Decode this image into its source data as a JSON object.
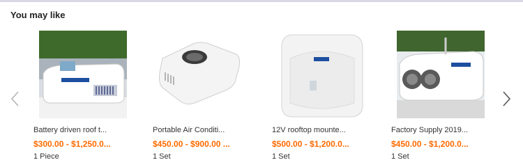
{
  "section": {
    "title": "You may like"
  },
  "nav": {
    "prev_icon": "chevron-left-icon",
    "next_icon": "chevron-right-icon"
  },
  "colors": {
    "price": "#ff6a00",
    "title_text": "#333333",
    "arrow": "#9a9a9a"
  },
  "products": [
    {
      "title": "Battery driven roof t...",
      "price": "$300.00 - $1,250.0...",
      "moq": "1 Piece",
      "image": "rooftop-ac-unit-on-truck-roof"
    },
    {
      "title": "Portable Air Conditi...",
      "price": "$450.00 - $900.00 ...",
      "moq": "1 Set",
      "image": "white-compact-ac-unit"
    },
    {
      "title": "12V rooftop mounte...",
      "price": "$500.00 - $1,200.0...",
      "moq": "1 Set",
      "image": "white-rooftop-ac-front-view"
    },
    {
      "title": "Factory Supply 2019...",
      "price": "$450.00 - $1,200.0...",
      "moq": "1 Set",
      "image": "rooftop-ac-with-twin-fans"
    }
  ]
}
